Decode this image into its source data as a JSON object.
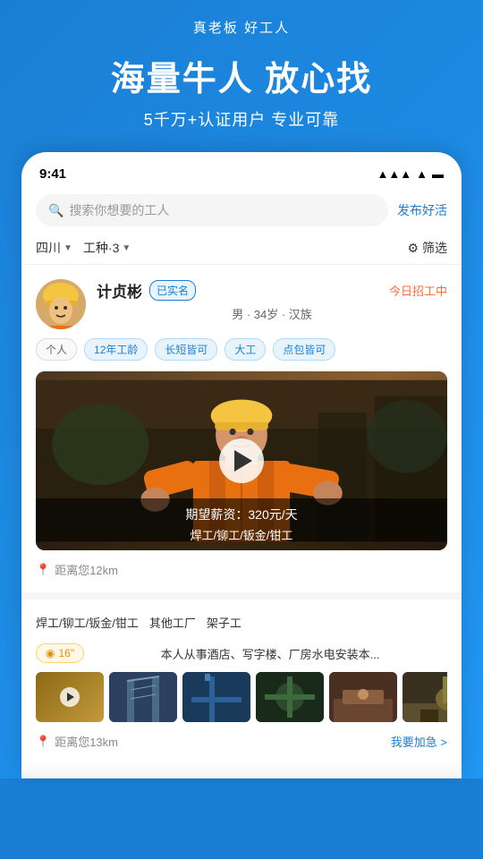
{
  "top": {
    "slogan": "真老板  好工人",
    "main_title": "海量牛人 放心找",
    "sub_title": "5千万+认证用户 专业可靠"
  },
  "status_bar": {
    "time": "9:41"
  },
  "search": {
    "placeholder": "搜索你想要的工人",
    "post_label": "发布好活"
  },
  "filters": {
    "region": "四川",
    "work_type": "工种·3",
    "screen": "筛选"
  },
  "worker1": {
    "name": "计贞彬",
    "verified": "已实名",
    "status": "今日招工中",
    "detail": "男 · 34岁 · 汉族",
    "tags": [
      "个人",
      "12年工龄",
      "长短皆可",
      "大工",
      "点包皆可"
    ],
    "salary": "期望薪资：320元/天",
    "skills": "焊工/铆工/钣金/钳工",
    "distance": "距离您12km"
  },
  "worker2": {
    "skill_filters": [
      "焊工/铆工/钣金/钳工",
      "其他工厂",
      "架子工"
    ],
    "voice_label": "16\"",
    "voice_text": "本人从事酒店、写字楼、厂房水电安装本...",
    "distance": "距离您13km",
    "urgent_btn": "我要加急 >"
  }
}
